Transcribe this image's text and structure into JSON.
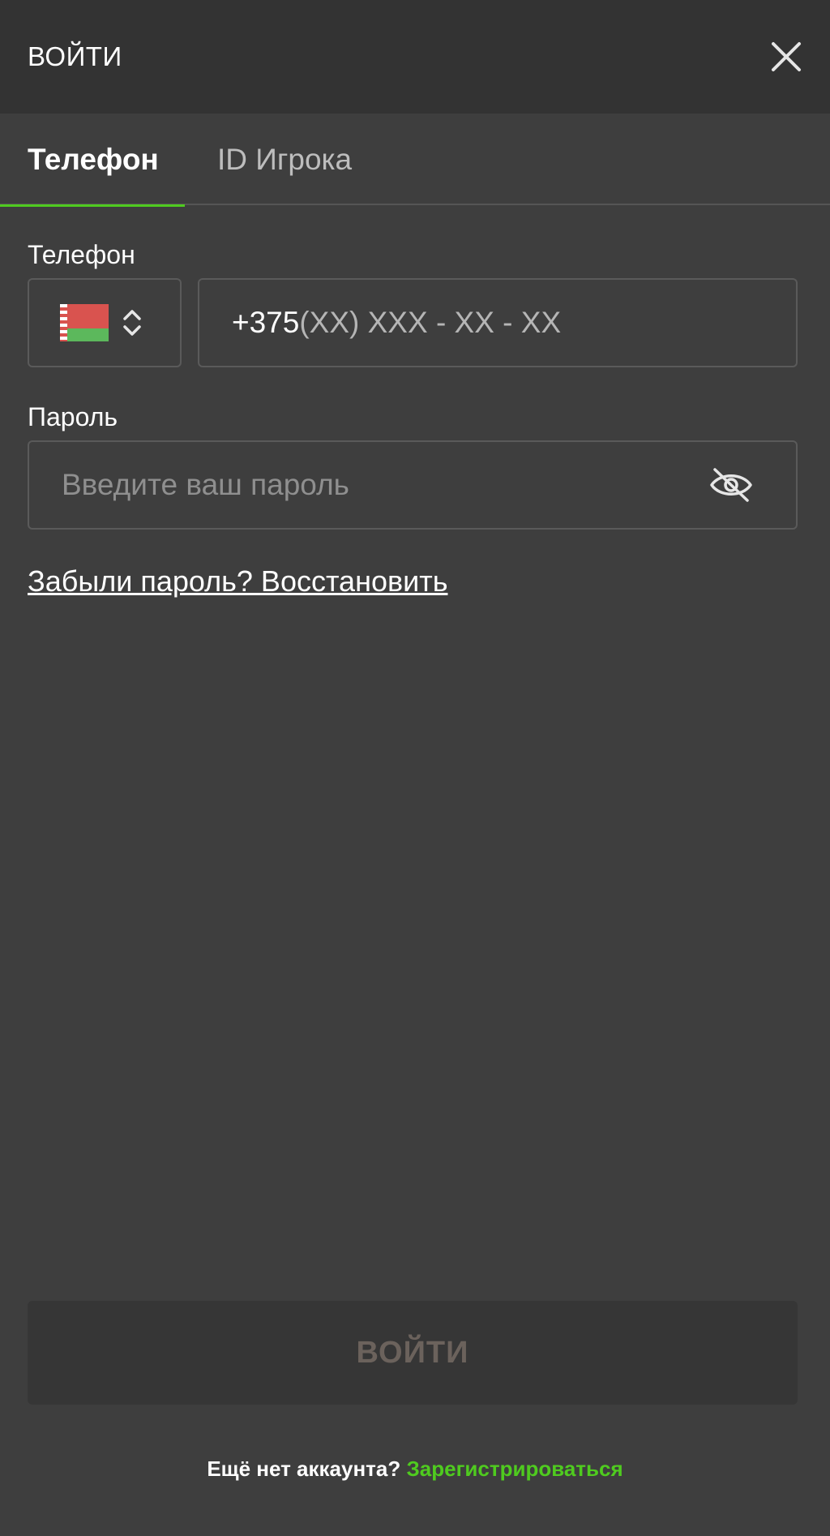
{
  "header": {
    "title": "ВОЙТИ",
    "close_icon": "close-icon"
  },
  "tabs": [
    {
      "label": "Телефон",
      "active": true
    },
    {
      "label": "ID Игрока",
      "active": false
    }
  ],
  "colors": {
    "accent": "#4fcb1f",
    "background": "#3e3e3e",
    "header_bg": "#333333"
  },
  "form": {
    "phone_label": "Телефон",
    "country_icon": "belarus-flag-icon",
    "phone_prefix": "+375",
    "phone_mask": "(XX) XXX - XX - XX",
    "password_label": "Пароль",
    "password_placeholder": "Введите ваш пароль",
    "password_toggle_icon": "eye-off-icon",
    "forgot_link": "Забыли пароль? Восстановить"
  },
  "submit": {
    "label": "ВОЙТИ"
  },
  "footer": {
    "question": "Ещё нет аккаунта?",
    "register_link": "Зарегистрироваться"
  }
}
